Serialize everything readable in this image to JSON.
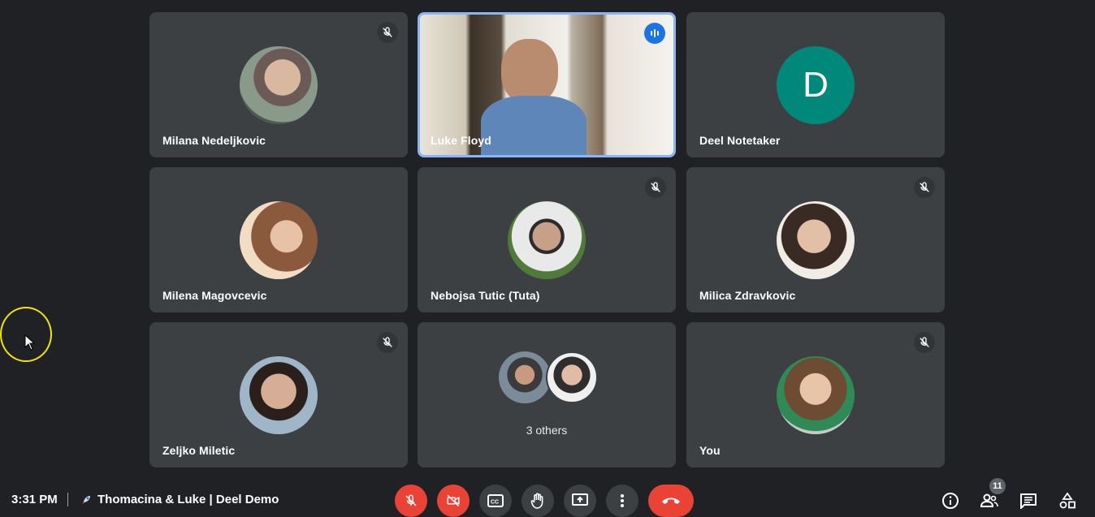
{
  "participants": [
    {
      "name": "Milana Nedeljkovic",
      "muted": true
    },
    {
      "name": "Luke Floyd",
      "speaking": true
    },
    {
      "name": "Deel Notetaker",
      "initial": "D"
    },
    {
      "name": "Milena Magovcevic"
    },
    {
      "name": "Nebojsa Tutic (Tuta)",
      "muted": true
    },
    {
      "name": "Milica Zdravkovic",
      "muted": true
    },
    {
      "name": "Zeljko Miletic",
      "muted": true
    },
    {
      "name": "3 others"
    },
    {
      "name": "You",
      "muted": true
    }
  ],
  "bottom_bar": {
    "time": "3:31 PM",
    "meeting_title": "Thomacina & Luke | Deel Demo",
    "people_count": "11"
  },
  "colors": {
    "background": "#202124",
    "tile": "#3c4043",
    "danger": "#ea4335",
    "active_border": "#8ab4f8",
    "avatar_teal": "#00897b"
  }
}
